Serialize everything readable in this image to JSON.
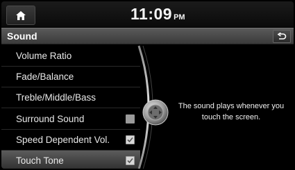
{
  "status": {
    "time": "11:09",
    "ampm": "PM"
  },
  "header": {
    "title": "Sound"
  },
  "menu": {
    "items": [
      {
        "label": "Volume Ratio"
      },
      {
        "label": "Fade/Balance"
      },
      {
        "label": "Treble/Middle/Bass"
      },
      {
        "label": "Surround Sound",
        "checkbox": "unchecked"
      },
      {
        "label": "Speed Dependent Vol.",
        "checkbox": "checked"
      },
      {
        "label": "Touch Tone",
        "checkbox": "checked",
        "selected": true
      }
    ]
  },
  "info": {
    "text": "The sound plays whenever you touch the screen."
  },
  "icons": {
    "home": "home-icon",
    "back": "back-arrow-icon",
    "knob": "scroll-knob-icon"
  },
  "colors": {
    "background": "#000000",
    "highlight": "#5c5c5c",
    "text": "#e8e8e8"
  }
}
